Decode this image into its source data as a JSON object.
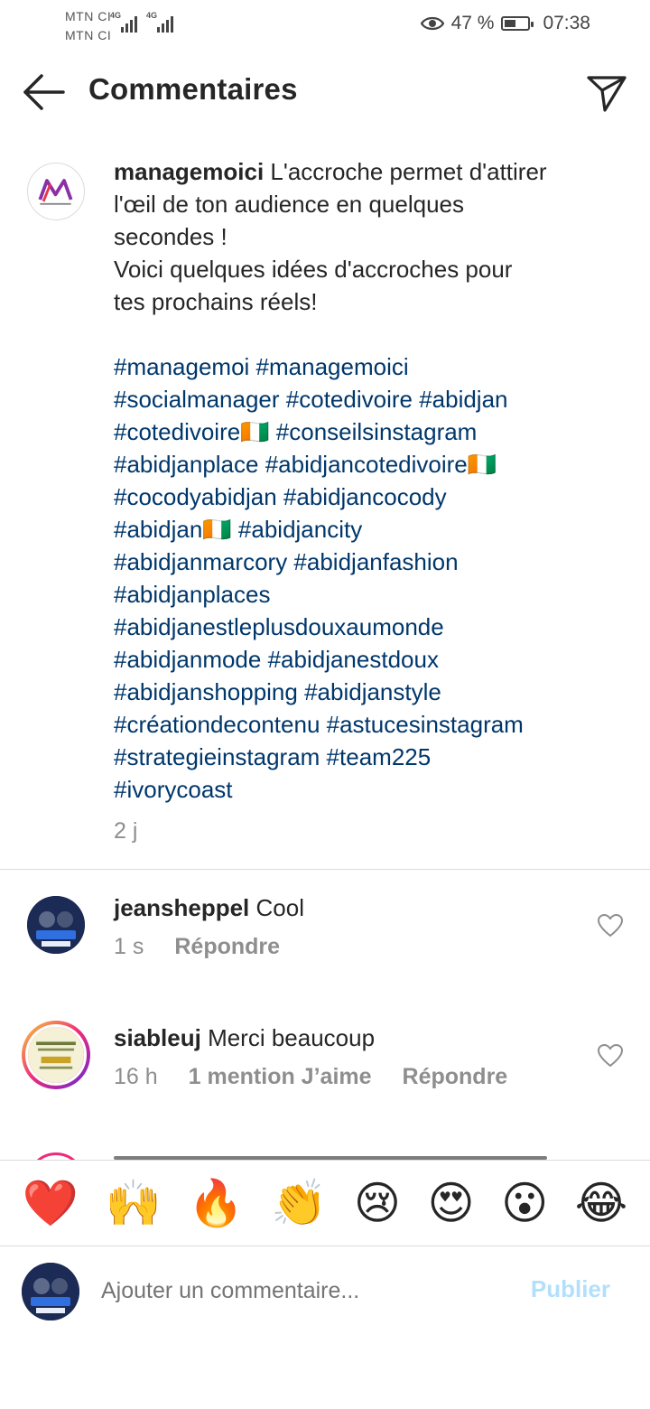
{
  "status_bar": {
    "carrier1": "MTN CI",
    "carrier2": "MTN CI",
    "network": "4G",
    "battery_percent": "47 %",
    "battery_level": 0.47,
    "time": "07:38",
    "eye_icon": "eye-icon"
  },
  "header": {
    "title": "Commentaires",
    "back_icon": "arrow-left-icon",
    "send_icon": "paper-plane-icon"
  },
  "caption": {
    "username": "managemoici",
    "text": "L'accroche permet d'attirer\nl'œil de ton audience en quelques\nsecondes !\nVoici quelques idées d'accroches pour\ntes prochains réels!",
    "hashtags": "#managemoi #managemoici\n#socialmanager #cotedivoire #abidjan\n#cotedivoire🇨🇮 #conseilsinstagram\n#abidjanplace #abidjancotedivoire🇨🇮\n#cocodyabidjan #abidjancocody\n#abidjan🇨🇮 #abidjancity\n#abidjanmarcory #abidjanfashion\n#abidjanplaces\n#abidjanestleplusdouxaumonde\n#abidjanmode #abidjanestdoux\n#abidjanshopping #abidjanstyle\n#créationdecontenu #astucesinstagram\n#strategieinstagram #team225\n#ivorycoast",
    "time": "2 j"
  },
  "comments": [
    {
      "username": "jeansheppel",
      "text": "Cool",
      "time": "1 s",
      "likes": "",
      "reply": "Répondre"
    },
    {
      "username": "siableuj",
      "text": "Merci beaucoup",
      "time": "16 h",
      "likes": "1 mention J’aime",
      "reply": "Répondre"
    }
  ],
  "emoji_bar": [
    "❤️",
    "🙌",
    "🔥",
    "👏",
    "😢",
    "😍",
    "😮",
    "😂"
  ],
  "composer": {
    "placeholder": "Ajouter un commentaire...",
    "publish": "Publier"
  },
  "colors": {
    "hashtag": "#00376b",
    "muted": "#8e8e8e",
    "publish_disabled": "#b2dffc"
  }
}
